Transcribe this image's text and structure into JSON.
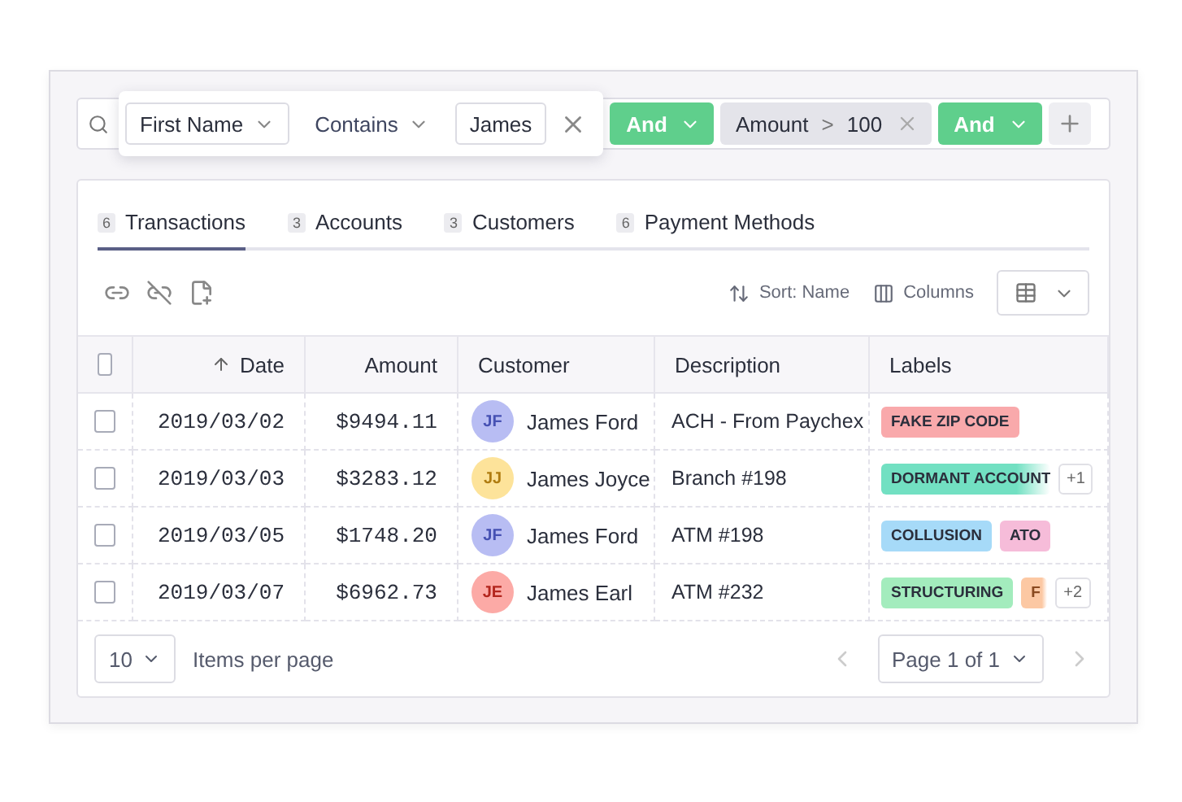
{
  "filter_bar": {
    "filters": [
      {
        "kind": "editor",
        "field": "First Name",
        "operator": "Contains",
        "value": "James"
      },
      {
        "kind": "join",
        "label": "And"
      },
      {
        "kind": "chip",
        "field": "Amount",
        "operator": ">",
        "value": "100"
      },
      {
        "kind": "join",
        "label": "And"
      },
      {
        "kind": "add"
      }
    ]
  },
  "tabs": [
    {
      "count": "6",
      "label": "Transactions",
      "selected": true
    },
    {
      "count": "3",
      "label": "Accounts",
      "selected": false
    },
    {
      "count": "3",
      "label": "Customers",
      "selected": false
    },
    {
      "count": "6",
      "label": "Payment Methods",
      "selected": false
    }
  ],
  "toolbar": {
    "sort": "Sort: Name",
    "columns": "Columns"
  },
  "table": {
    "columns": [
      {
        "label": "Date",
        "sorted": true,
        "kind": "numeric"
      },
      {
        "label": "Amount",
        "sorted": false,
        "kind": "numeric"
      },
      {
        "label": "Customer",
        "sorted": false,
        "kind": "text"
      },
      {
        "label": "Description",
        "sorted": false,
        "kind": "text"
      },
      {
        "label": "Labels",
        "sorted": false,
        "kind": "text"
      }
    ],
    "header_checked": false,
    "rows": [
      {
        "checked": false,
        "date": "2019/03/02",
        "amount": "$9494.11",
        "customer": {
          "initials": "JF",
          "name": "James Ford",
          "color": "#b8bdf3"
        },
        "description": "ACH - From Paychex",
        "labels": [
          {
            "text": "FAKE ZIP CODE",
            "color": "#f9a9ab",
            "faded": false
          }
        ]
      },
      {
        "checked": false,
        "date": "2019/03/03",
        "amount": "$3283.12",
        "customer": {
          "initials": "JJ",
          "name": "James Joyce",
          "color": "#fde39a"
        },
        "description": "Branch #198",
        "labels": [
          {
            "text": "DORMANT ACCOUNT",
            "color": "#72e0c2",
            "faded": true
          }
        ],
        "more": "+1"
      },
      {
        "checked": false,
        "date": "2019/03/05",
        "amount": "$1748.20",
        "customer": {
          "initials": "JF",
          "name": "James Ford",
          "color": "#b8bdf3"
        },
        "description": "ATM #198",
        "labels": [
          {
            "text": "COLLUSION",
            "color": "#a6daf8",
            "faded": false
          },
          {
            "text": "ATO",
            "color": "#f6bcd9",
            "faded": false
          }
        ]
      },
      {
        "checked": false,
        "date": "2019/03/07",
        "amount": "$6962.73",
        "customer": {
          "initials": "JE",
          "name": "James Earl",
          "color": "#fcaaa6"
        },
        "description": "ATM #232",
        "labels": [
          {
            "text": "STRUCTURING",
            "color": "#a3ecbd",
            "faded": false
          },
          {
            "text": "F",
            "color": "#fcc8a3",
            "faded": true
          }
        ],
        "more": "+2"
      }
    ]
  },
  "pagination": {
    "page_size": "10",
    "page_size_label": "Items per page",
    "page": "Page 1 of 1"
  }
}
